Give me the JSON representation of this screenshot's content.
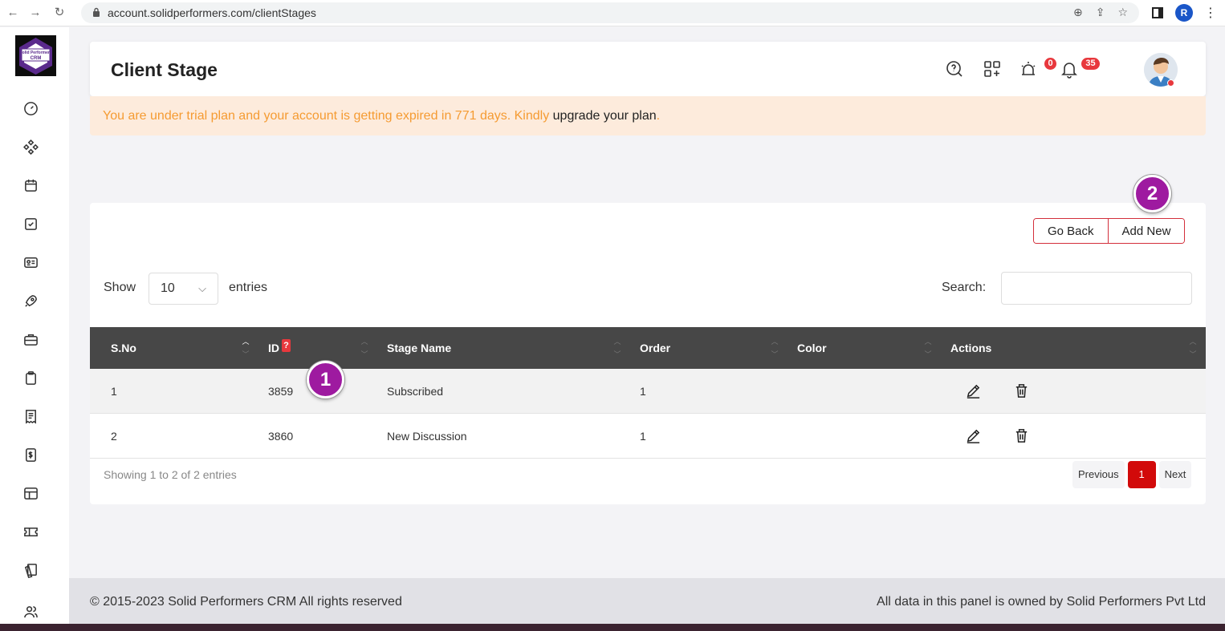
{
  "browser": {
    "url": "account.solidperformers.com/clientStages",
    "profile_initial": "R"
  },
  "sidebar": {
    "logo_text_top": "Solid Performers",
    "logo_text_bottom": "CRM",
    "icons": [
      "dashboard-icon",
      "modules-icon",
      "calendar-icon",
      "tasks-icon",
      "contacts-card-icon",
      "rocket-icon",
      "briefcase-icon",
      "clipboard-icon",
      "receipt-icon",
      "invoice-icon",
      "table-icon",
      "ticket-icon",
      "documents-icon",
      "users-icon"
    ]
  },
  "header": {
    "title": "Client Stage",
    "alarm_count": "0",
    "notification_count": "35"
  },
  "trial": {
    "message": "You are under trial plan and your account is getting expired in 771 days. Kindly ",
    "link": "upgrade your plan",
    "suffix": "."
  },
  "markers": {
    "one": "1",
    "two": "2"
  },
  "actions": {
    "go_back": "Go Back",
    "add_new": "Add New"
  },
  "table_controls": {
    "show_label": "Show",
    "entries_value": "10",
    "entries_label": "entries",
    "search_label": "Search:"
  },
  "table": {
    "columns": [
      "S.No",
      "ID",
      "Stage Name",
      "Order",
      "Color",
      "Actions"
    ],
    "id_help": "?",
    "rows": [
      {
        "sno": "1",
        "id": "3859",
        "stage": "Subscribed",
        "order": "1",
        "color": ""
      },
      {
        "sno": "2",
        "id": "3860",
        "stage": "New Discussion",
        "order": "1",
        "color": ""
      }
    ]
  },
  "pagination": {
    "info": "Showing 1 to 2 of 2 entries",
    "previous": "Previous",
    "current": "1",
    "next": "Next"
  },
  "footer": {
    "copyright": "© 2015-2023 Solid Performers CRM All rights reserved",
    "ownership": "All data in this panel is owned by Solid Performers Pvt Ltd"
  },
  "colors": {
    "accent_red": "#d32f3b",
    "marker_purple": "#9e1aa0",
    "table_header": "#474747",
    "trial_bg": "#fdebdc",
    "trial_text": "#f59b32"
  }
}
